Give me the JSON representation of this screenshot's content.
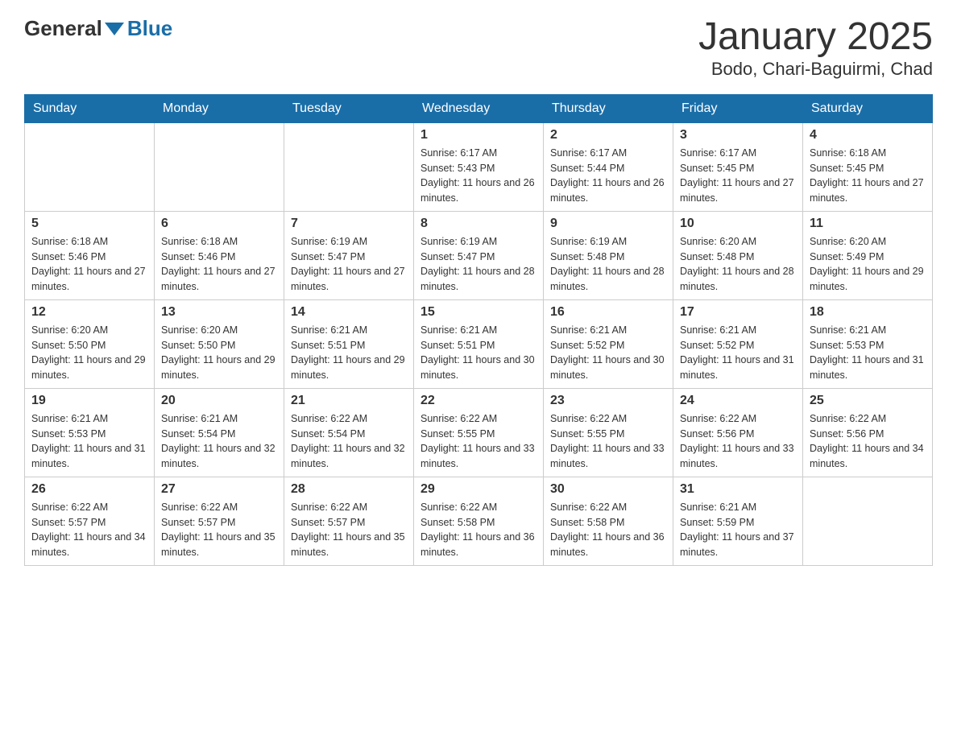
{
  "header": {
    "logo_general": "General",
    "logo_blue": "Blue",
    "title": "January 2025",
    "location": "Bodo, Chari-Baguirmi, Chad"
  },
  "days_of_week": [
    "Sunday",
    "Monday",
    "Tuesday",
    "Wednesday",
    "Thursday",
    "Friday",
    "Saturday"
  ],
  "weeks": [
    [
      {
        "day": "",
        "info": ""
      },
      {
        "day": "",
        "info": ""
      },
      {
        "day": "",
        "info": ""
      },
      {
        "day": "1",
        "info": "Sunrise: 6:17 AM\nSunset: 5:43 PM\nDaylight: 11 hours and 26 minutes."
      },
      {
        "day": "2",
        "info": "Sunrise: 6:17 AM\nSunset: 5:44 PM\nDaylight: 11 hours and 26 minutes."
      },
      {
        "day": "3",
        "info": "Sunrise: 6:17 AM\nSunset: 5:45 PM\nDaylight: 11 hours and 27 minutes."
      },
      {
        "day": "4",
        "info": "Sunrise: 6:18 AM\nSunset: 5:45 PM\nDaylight: 11 hours and 27 minutes."
      }
    ],
    [
      {
        "day": "5",
        "info": "Sunrise: 6:18 AM\nSunset: 5:46 PM\nDaylight: 11 hours and 27 minutes."
      },
      {
        "day": "6",
        "info": "Sunrise: 6:18 AM\nSunset: 5:46 PM\nDaylight: 11 hours and 27 minutes."
      },
      {
        "day": "7",
        "info": "Sunrise: 6:19 AM\nSunset: 5:47 PM\nDaylight: 11 hours and 27 minutes."
      },
      {
        "day": "8",
        "info": "Sunrise: 6:19 AM\nSunset: 5:47 PM\nDaylight: 11 hours and 28 minutes."
      },
      {
        "day": "9",
        "info": "Sunrise: 6:19 AM\nSunset: 5:48 PM\nDaylight: 11 hours and 28 minutes."
      },
      {
        "day": "10",
        "info": "Sunrise: 6:20 AM\nSunset: 5:48 PM\nDaylight: 11 hours and 28 minutes."
      },
      {
        "day": "11",
        "info": "Sunrise: 6:20 AM\nSunset: 5:49 PM\nDaylight: 11 hours and 29 minutes."
      }
    ],
    [
      {
        "day": "12",
        "info": "Sunrise: 6:20 AM\nSunset: 5:50 PM\nDaylight: 11 hours and 29 minutes."
      },
      {
        "day": "13",
        "info": "Sunrise: 6:20 AM\nSunset: 5:50 PM\nDaylight: 11 hours and 29 minutes."
      },
      {
        "day": "14",
        "info": "Sunrise: 6:21 AM\nSunset: 5:51 PM\nDaylight: 11 hours and 29 minutes."
      },
      {
        "day": "15",
        "info": "Sunrise: 6:21 AM\nSunset: 5:51 PM\nDaylight: 11 hours and 30 minutes."
      },
      {
        "day": "16",
        "info": "Sunrise: 6:21 AM\nSunset: 5:52 PM\nDaylight: 11 hours and 30 minutes."
      },
      {
        "day": "17",
        "info": "Sunrise: 6:21 AM\nSunset: 5:52 PM\nDaylight: 11 hours and 31 minutes."
      },
      {
        "day": "18",
        "info": "Sunrise: 6:21 AM\nSunset: 5:53 PM\nDaylight: 11 hours and 31 minutes."
      }
    ],
    [
      {
        "day": "19",
        "info": "Sunrise: 6:21 AM\nSunset: 5:53 PM\nDaylight: 11 hours and 31 minutes."
      },
      {
        "day": "20",
        "info": "Sunrise: 6:21 AM\nSunset: 5:54 PM\nDaylight: 11 hours and 32 minutes."
      },
      {
        "day": "21",
        "info": "Sunrise: 6:22 AM\nSunset: 5:54 PM\nDaylight: 11 hours and 32 minutes."
      },
      {
        "day": "22",
        "info": "Sunrise: 6:22 AM\nSunset: 5:55 PM\nDaylight: 11 hours and 33 minutes."
      },
      {
        "day": "23",
        "info": "Sunrise: 6:22 AM\nSunset: 5:55 PM\nDaylight: 11 hours and 33 minutes."
      },
      {
        "day": "24",
        "info": "Sunrise: 6:22 AM\nSunset: 5:56 PM\nDaylight: 11 hours and 33 minutes."
      },
      {
        "day": "25",
        "info": "Sunrise: 6:22 AM\nSunset: 5:56 PM\nDaylight: 11 hours and 34 minutes."
      }
    ],
    [
      {
        "day": "26",
        "info": "Sunrise: 6:22 AM\nSunset: 5:57 PM\nDaylight: 11 hours and 34 minutes."
      },
      {
        "day": "27",
        "info": "Sunrise: 6:22 AM\nSunset: 5:57 PM\nDaylight: 11 hours and 35 minutes."
      },
      {
        "day": "28",
        "info": "Sunrise: 6:22 AM\nSunset: 5:57 PM\nDaylight: 11 hours and 35 minutes."
      },
      {
        "day": "29",
        "info": "Sunrise: 6:22 AM\nSunset: 5:58 PM\nDaylight: 11 hours and 36 minutes."
      },
      {
        "day": "30",
        "info": "Sunrise: 6:22 AM\nSunset: 5:58 PM\nDaylight: 11 hours and 36 minutes."
      },
      {
        "day": "31",
        "info": "Sunrise: 6:21 AM\nSunset: 5:59 PM\nDaylight: 11 hours and 37 minutes."
      },
      {
        "day": "",
        "info": ""
      }
    ]
  ]
}
